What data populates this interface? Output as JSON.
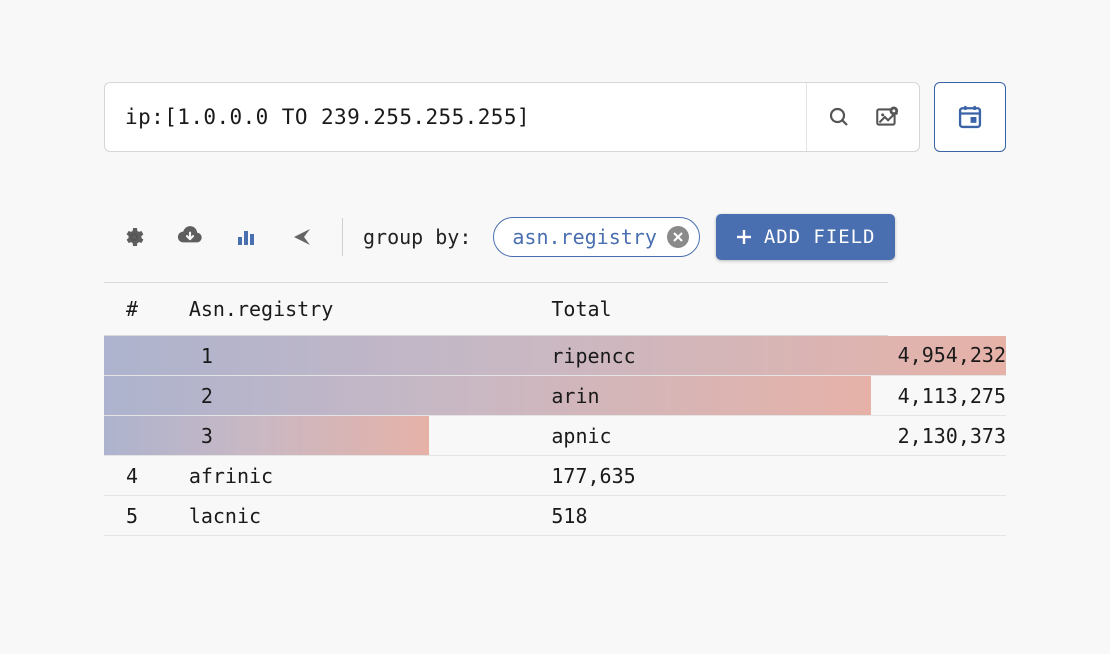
{
  "search": {
    "value": "ip:[1.0.0.0 TO 239.255.255.255]"
  },
  "toolbar": {
    "group_by_label": "group by:",
    "chip_label": "asn.registry",
    "add_field_label": "ADD FIELD"
  },
  "table": {
    "headers": {
      "num": "#",
      "registry": "Asn.registry",
      "total": "Total"
    },
    "rows": [
      {
        "n": "1",
        "reg": "ripencc",
        "total": "4,954,232",
        "bar": 100
      },
      {
        "n": "2",
        "reg": "arin",
        "total": "4,113,275",
        "bar": 85
      },
      {
        "n": "3",
        "reg": "apnic",
        "total": "2,130,373",
        "bar": 36
      },
      {
        "n": "4",
        "reg": "afrinic",
        "total": "177,635",
        "bar": 0
      },
      {
        "n": "5",
        "reg": "lacnic",
        "total": "518",
        "bar": 0
      }
    ]
  },
  "chart_data": {
    "type": "bar",
    "title": "",
    "xlabel": "Asn.registry",
    "ylabel": "Total",
    "categories": [
      "ripencc",
      "arin",
      "apnic",
      "afrinic",
      "lacnic"
    ],
    "values": [
      4954232,
      4113275,
      2130373,
      177635,
      518
    ],
    "ylim": [
      0,
      5000000
    ]
  }
}
